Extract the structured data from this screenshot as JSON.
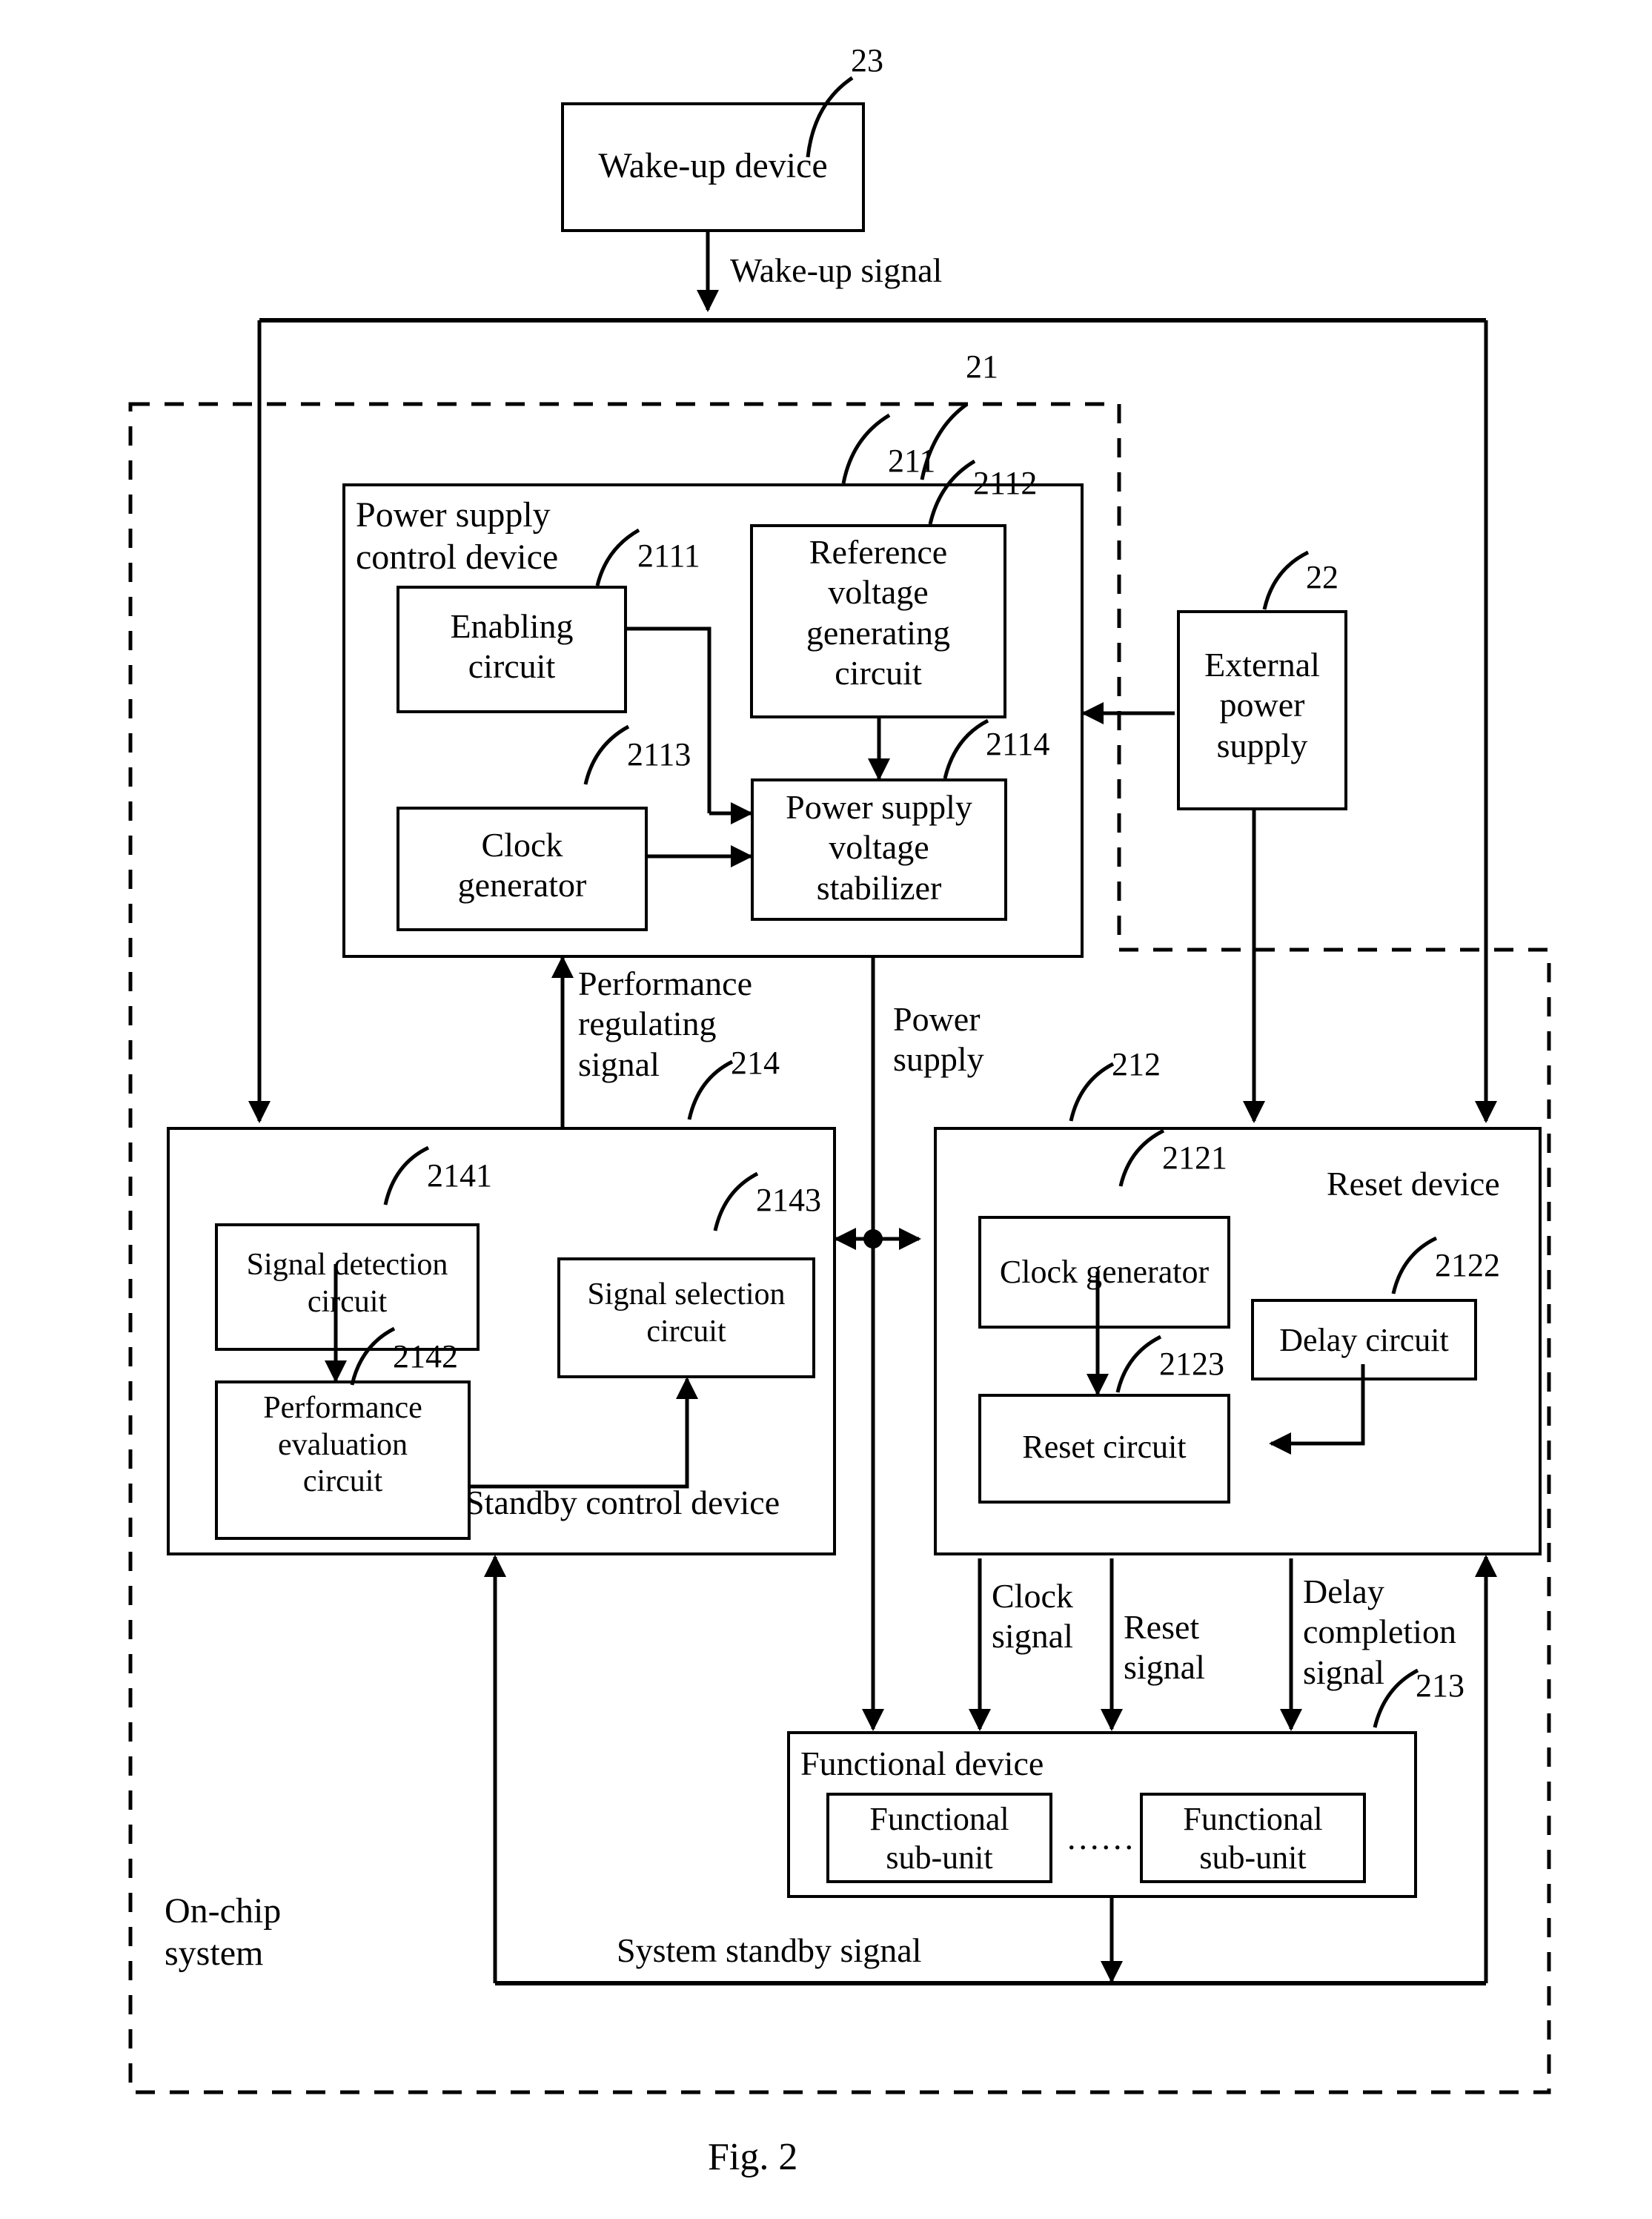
{
  "figure": {
    "caption": "Fig. 2",
    "system_boundary_label": "On-chip\nsystem"
  },
  "blocks": {
    "wakeup_device": {
      "label": "Wake-up device",
      "ref": "23"
    },
    "onchip_system": {
      "ref": "21"
    },
    "power_supply_control_device": {
      "label": "Power supply\ncontrol device",
      "ref": "211"
    },
    "enabling_circuit": {
      "label": "Enabling\ncircuit",
      "ref": "2111"
    },
    "reference_voltage_generating_circuit": {
      "label": "Reference\nvoltage\ngenerating\ncircuit",
      "ref": "2112"
    },
    "clock_generator_psc": {
      "label": "Clock\ngenerator",
      "ref": "2113"
    },
    "power_supply_voltage_stabilizer": {
      "label": "Power supply\nvoltage\nstabilizer",
      "ref": "2114"
    },
    "external_power_supply": {
      "label": "External\npower\nsupply",
      "ref": "22"
    },
    "standby_control_device": {
      "label": "Standby control device",
      "ref": "214"
    },
    "signal_detection_circuit": {
      "label": "Signal detection\ncircuit",
      "ref": "2141"
    },
    "performance_evaluation_circuit": {
      "label": "Performance\nevaluation\ncircuit",
      "ref": "2142"
    },
    "signal_selection_circuit": {
      "label": "Signal selection\ncircuit",
      "ref": "2143"
    },
    "reset_device": {
      "label": "Reset device",
      "ref": "212"
    },
    "clock_generator_reset": {
      "label": "Clock generator",
      "ref": "2121"
    },
    "delay_circuit": {
      "label": "Delay circuit",
      "ref": "2122"
    },
    "reset_circuit": {
      "label": "Reset circuit",
      "ref": "2123"
    },
    "functional_device": {
      "label": "Functional device",
      "ref": "213"
    },
    "functional_sub_unit_1": {
      "label": "Functional\nsub-unit"
    },
    "functional_sub_unit_2": {
      "label": "Functional\nsub-unit"
    },
    "ellipsis": {
      "label": "......"
    }
  },
  "signals": {
    "wakeup_signal": "Wake-up signal",
    "performance_regulating_signal": "Performance\nregulating\nsignal",
    "power_supply": "Power\nsupply",
    "clock_signal": "Clock\nsignal",
    "reset_signal": "Reset\nsignal",
    "delay_completion_signal": "Delay\ncompletion\nsignal",
    "system_standby_signal": "System standby signal"
  },
  "colors": {
    "stroke": "#000000",
    "background": "#ffffff"
  }
}
